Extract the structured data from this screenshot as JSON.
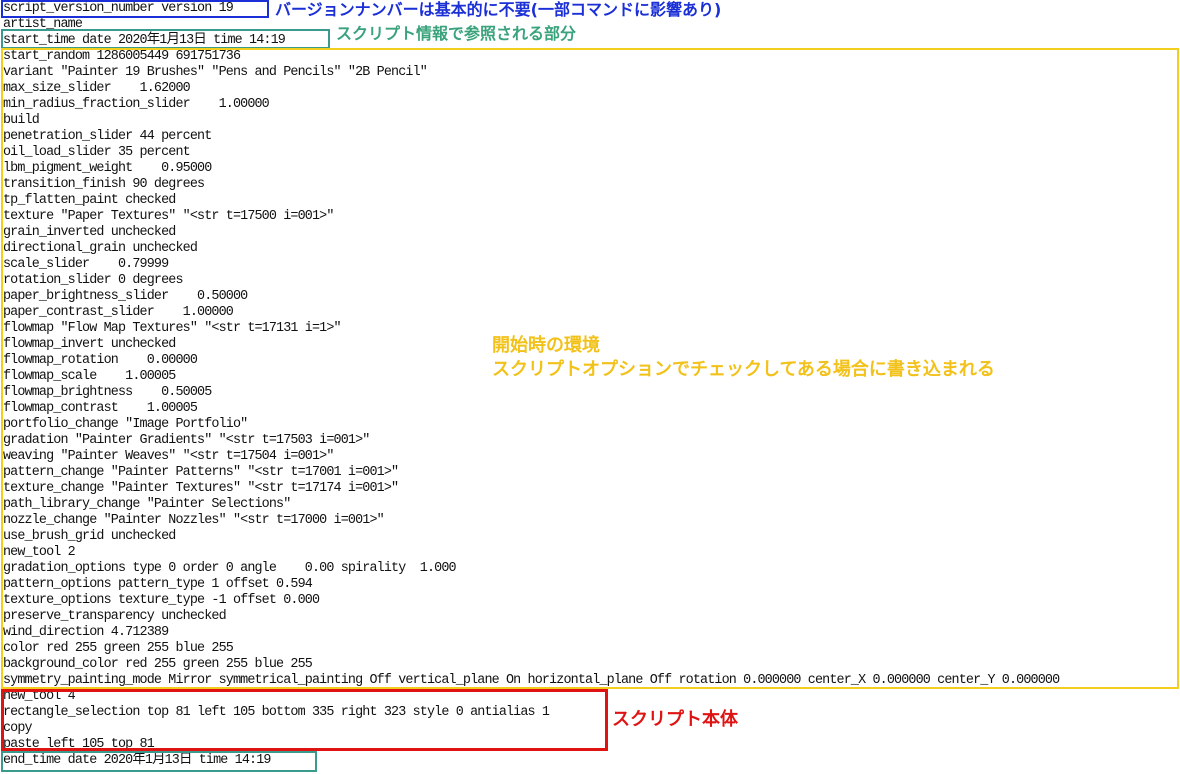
{
  "colors": {
    "version_box": "#1a2fd6",
    "info_box": "#3a9a8e",
    "env_box": "#f2cf1f",
    "body_box": "#e01313",
    "version_note": "#1a2fd6",
    "info_note": "#3aa37c",
    "env_note": "#f2c21a",
    "body_note": "#e01313"
  },
  "annotations": {
    "version_note": "バージョンナンバーは基本的に不要(一部コマンドに影響あり)",
    "info_note": "スクリプト情報で参照される部分",
    "env_note_line1": "開始時の環境",
    "env_note_line2": "スクリプトオプションでチェックしてある場合に書き込まれる",
    "body_note": "スクリプト本体"
  },
  "script_lines": [
    "script_version_number version 19",
    "artist_name",
    "start_time date 2020年1月13日 time 14:19",
    "start_random 1286005449 691751736",
    "variant \"Painter 19 Brushes\" \"Pens and Pencils\" \"2B Pencil\"",
    "max_size_slider    1.62000",
    "min_radius_fraction_slider    1.00000",
    "build",
    "penetration_slider 44 percent",
    "oil_load_slider 35 percent",
    "lbm_pigment_weight    0.95000",
    "transition_finish 90 degrees",
    "tp_flatten_paint checked",
    "texture \"Paper Textures\" \"<str t=17500 i=001>\"",
    "grain_inverted unchecked",
    "directional_grain unchecked",
    "scale_slider    0.79999",
    "rotation_slider 0 degrees",
    "paper_brightness_slider    0.50000",
    "paper_contrast_slider    1.00000",
    "flowmap \"Flow Map Textures\" \"<str t=17131 i=1>\"",
    "flowmap_invert unchecked",
    "flowmap_rotation    0.00000",
    "flowmap_scale    1.00005",
    "flowmap_brightness    0.50005",
    "flowmap_contrast    1.00005",
    "portfolio_change \"Image Portfolio\"",
    "gradation \"Painter Gradients\" \"<str t=17503 i=001>\"",
    "weaving \"Painter Weaves\" \"<str t=17504 i=001>\"",
    "pattern_change \"Painter Patterns\" \"<str t=17001 i=001>\"",
    "texture_change \"Painter Textures\" \"<str t=17174 i=001>\"",
    "path_library_change \"Painter Selections\"",
    "nozzle_change \"Painter Nozzles\" \"<str t=17000 i=001>\"",
    "use_brush_grid unchecked",
    "new_tool 2",
    "gradation_options type 0 order 0 angle    0.00 spirality  1.000",
    "pattern_options pattern_type 1 offset 0.594",
    "texture_options texture_type -1 offset 0.000",
    "preserve_transparency unchecked",
    "wind_direction 4.712389",
    "color red 255 green 255 blue 255",
    "background_color red 255 green 255 blue 255",
    "symmetry_painting_mode Mirror symmetrical_painting Off vertical_plane On horizontal_plane Off rotation 0.000000 center_X 0.000000 center_Y 0.000000",
    "new_tool 4",
    "rectangle_selection top 81 left 105 bottom 335 right 323 style 0 antialias 1",
    "copy",
    "paste left 105 top 81",
    "end_time date 2020年1月13日 time 14:19"
  ]
}
